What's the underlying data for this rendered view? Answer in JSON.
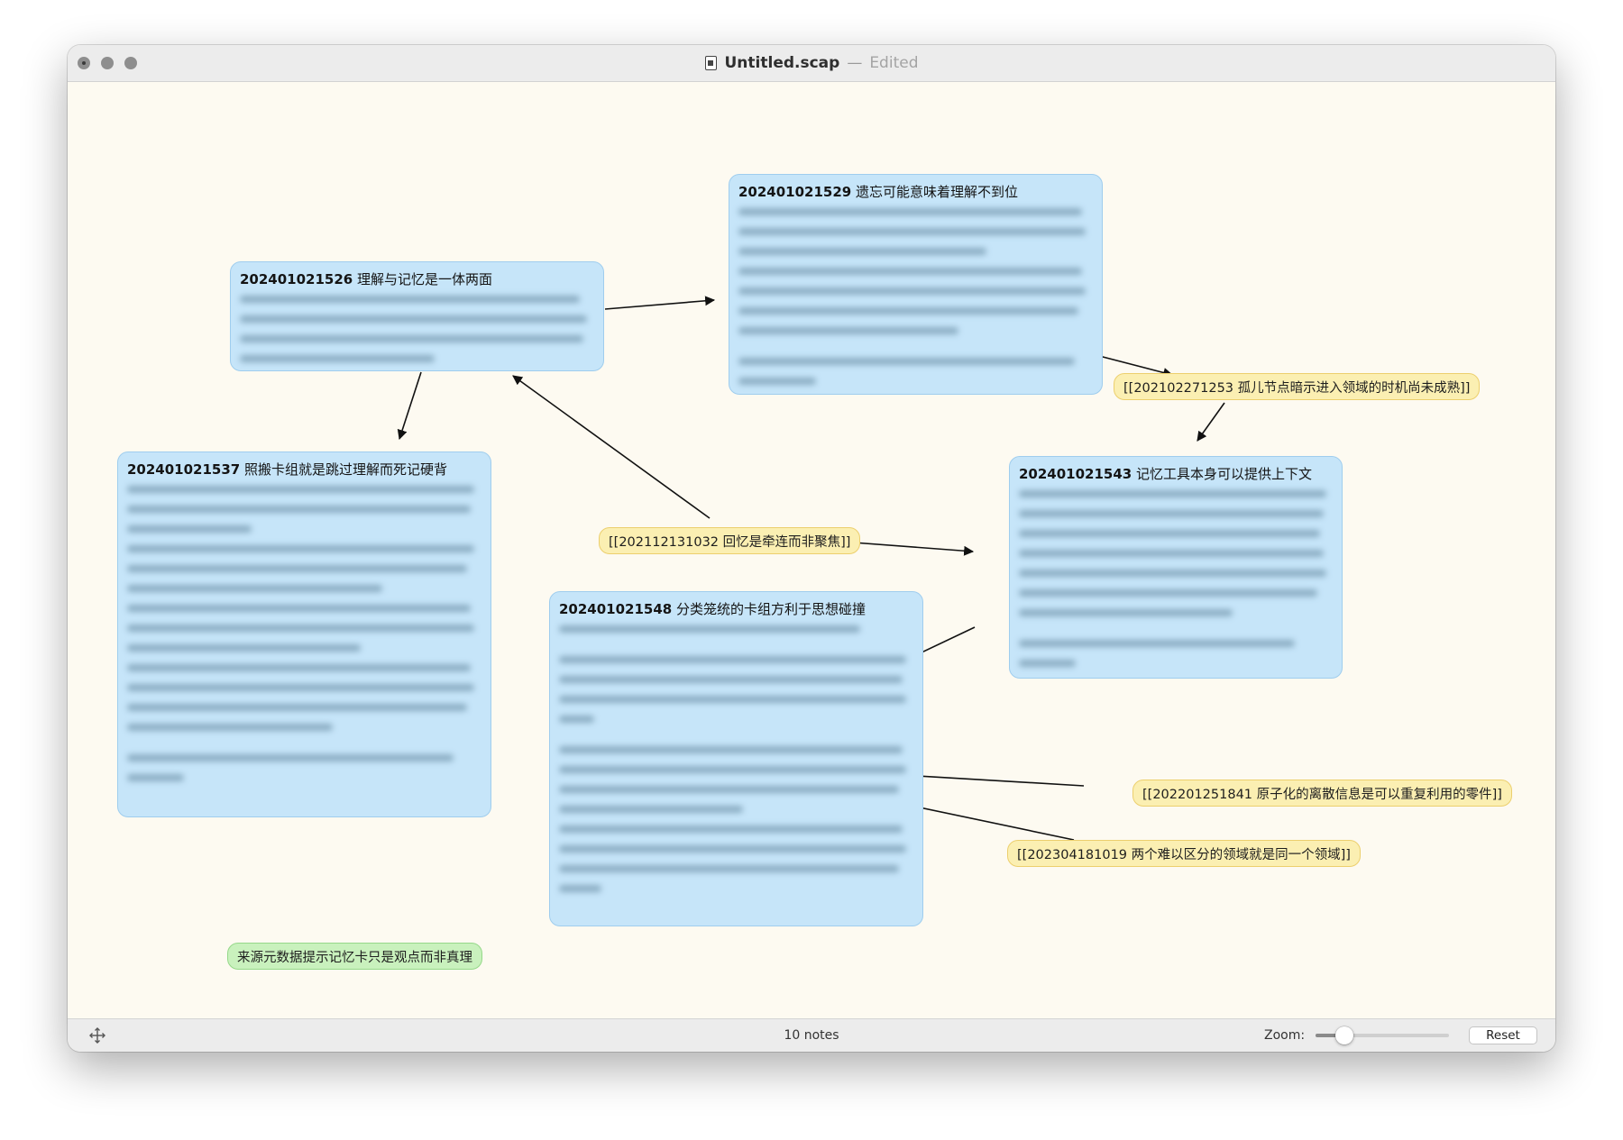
{
  "window": {
    "title": "Untitled.scap",
    "separator": "—",
    "status": "Edited",
    "doc_icon": "document-icon"
  },
  "notes": [
    {
      "id": "202401021526",
      "title": "理解与记忆是一体两面",
      "body_visible": false
    },
    {
      "id": "202401021529",
      "title": "遗忘可能意味着理解不到位",
      "body_visible": false
    },
    {
      "id": "202401021537",
      "title": "照搬卡组就是跳过理解而死记硬背",
      "body_visible": false
    },
    {
      "id": "202401021543",
      "title": "记忆工具本身可以提供上下文",
      "body_visible": false
    },
    {
      "id": "202401021548",
      "title": "分类笼统的卡组方利于思想碰撞",
      "body_visible": false
    }
  ],
  "links": [
    "[[202102271253 孤儿节点暗示进入领域的时机尚未成熟]]",
    "[[202112131032 回忆是牵连而非聚焦]]",
    "[[202201251841 原子化的离散信息是可以重复利用的零件]]",
    "[[202304181019 两个难以区分的领域就是同一个领域]]"
  ],
  "green_note": "来源元数据提示记忆卡只是观点而非真理",
  "colors": {
    "note_fill": "#c6e5f9",
    "note_border": "#9fcdee",
    "link_fill": "#fbefb2",
    "link_border": "#eccf6d",
    "green_fill": "#c9f1bd",
    "green_border": "#95d889",
    "canvas": "#fdfaf1"
  },
  "statusbar": {
    "move_icon": "move-arrows-icon",
    "note_count": "10 notes",
    "zoom_label": "Zoom:",
    "zoom_fraction": 0.17,
    "reset_label": "Reset"
  }
}
